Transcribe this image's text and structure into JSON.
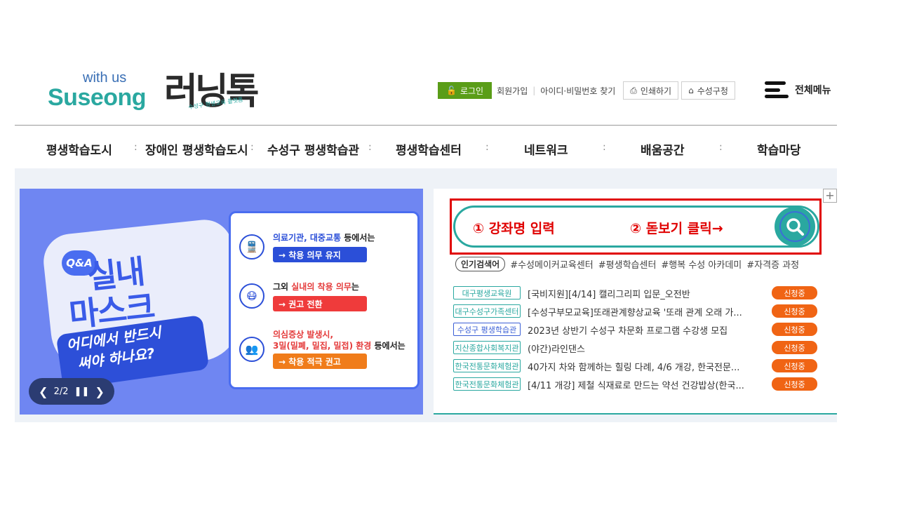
{
  "logo": {
    "with_us": "with us",
    "brand": "Suseong",
    "name": "러닝톡",
    "tag": "수성구 평생교육 플랫폼"
  },
  "util": {
    "login": "로그인",
    "join": "회원가입",
    "find": "아이디·비밀번호 찾기",
    "print": "인쇄하기",
    "office": "수성구청",
    "all_menu": "전체메뉴"
  },
  "gnb": [
    "평생학습도시",
    "장애인 평생학습도시",
    "수성구 평생학습관",
    "평생학습센터",
    "네트워크",
    "배움공간",
    "학습마당"
  ],
  "banner": {
    "qa": "Q&A",
    "title1": "실내",
    "title2": "마스크",
    "sub1": "어디에서 반드시",
    "sub2": "써야 하나요?",
    "rows": [
      {
        "icon": "train-icon",
        "text_a": "의료기관, 대중교통",
        "text_b": " 등에서는",
        "pill": "→ 착용 의무 유지",
        "pill_color": "#2b4fd8"
      },
      {
        "icon": "mask-icon",
        "text_a": "그외 ",
        "text_b": "실내의 착용 의무",
        "text_c": "는",
        "pill": "→ 권고 전환",
        "pill_color": "#ef3b3b"
      },
      {
        "icon": "people-icon",
        "text_a": "의심증상 발생시,",
        "text_b": "3밀(밀폐, 밀집, 밀접) 환경",
        "text_c": " 등에서는",
        "pill": "→ 착용 적극 권고",
        "pill_color": "#f07c1a"
      }
    ],
    "counter": "2/2"
  },
  "search": {
    "hint1": "① 강좌명 입력",
    "hint2": "② 돋보기 클릭→"
  },
  "popular": {
    "label": "인기검색어",
    "keywords": [
      "#수성메이커교육센터",
      "#평생학습센터",
      "#행복 수성 아카데미",
      "#자격증 과정"
    ]
  },
  "courses": [
    {
      "category": "대구평생교육원",
      "title": "[국비지원][4/14] 캘리그리피 입문_오전반",
      "status": "신청중",
      "blue": false
    },
    {
      "category": "대구수성구가족센터",
      "title": "[수성구부모교육]또래관계향상교육 '또래 관계 오래 가...",
      "status": "신청중",
      "blue": false
    },
    {
      "category": "수성구 평생학습관",
      "title": "2023년 상반기 수성구 차문화 프로그램 수강생 모집",
      "status": "신청중",
      "blue": true
    },
    {
      "category": "지산종합사회복지관",
      "title": "(야간)라인댄스",
      "status": "신청중",
      "blue": false
    },
    {
      "category": "한국전통문화체험관",
      "title": "40가지 차와 함께하는 힐링 다례, 4/6 개강, 한국전문...",
      "status": "신청중",
      "blue": false
    },
    {
      "category": "한국전통문화체험관",
      "title": "[4/11 개강] 제철 식재료로 만드는 약선 건강밥상(한국...",
      "status": "신청중",
      "blue": false
    }
  ],
  "colors": {
    "accent": "#2aa8a0",
    "login_green": "#5a9d18",
    "status_orange": "#f06414",
    "highlight_red": "#e00000",
    "banner_blue": "#6f86f2"
  }
}
